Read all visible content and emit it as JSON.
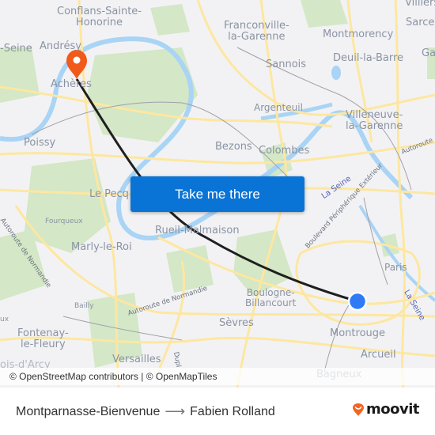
{
  "map": {
    "places": [
      {
        "name": "Conflans-Sainte-\nHonorine",
        "size": "lg"
      },
      {
        "name": "Andrésy",
        "size": "lg"
      },
      {
        "name": "-Seine",
        "size": "lg"
      },
      {
        "name": "Achères",
        "size": "lg"
      },
      {
        "name": "Poissy",
        "size": "lg"
      },
      {
        "name": "Franconville-\nla-Garenne",
        "size": "lg"
      },
      {
        "name": "Sannois",
        "size": "lg"
      },
      {
        "name": "Montmorency",
        "size": "lg"
      },
      {
        "name": "Deuil-la-Barre",
        "size": "lg"
      },
      {
        "name": "Villiers",
        "size": "lg"
      },
      {
        "name": "Sarce",
        "size": "lg"
      },
      {
        "name": "Ga",
        "size": "lg"
      },
      {
        "name": "Argenteuil",
        "size": "md"
      },
      {
        "name": "Villeneuve-\nla-Garenne",
        "size": "lg"
      },
      {
        "name": "Bezons",
        "size": "lg"
      },
      {
        "name": "Colombes",
        "size": "lg"
      },
      {
        "name": "Le Pecq",
        "size": "lg"
      },
      {
        "name": "Fourqueux",
        "size": "sm"
      },
      {
        "name": "Rueil-Malmaison",
        "size": "lg"
      },
      {
        "name": "Marly-le-Roi",
        "size": "lg"
      },
      {
        "name": "Paris",
        "size": "md"
      },
      {
        "name": "Boulogne-\nBillancourt",
        "size": "md"
      },
      {
        "name": "Bailly",
        "size": "sm"
      },
      {
        "name": "ux",
        "size": "sm"
      },
      {
        "name": "Fontenay-\nle-Fleury",
        "size": "lg"
      },
      {
        "name": "Sèvres",
        "size": "lg"
      },
      {
        "name": "Montrouge",
        "size": "lg"
      },
      {
        "name": "Arcueil",
        "size": "lg"
      },
      {
        "name": "Versailles",
        "size": "lg"
      },
      {
        "name": "Bagneux",
        "size": "lg"
      },
      {
        "name": "ois-d'Arcy",
        "size": "lg"
      }
    ],
    "roads": [
      "Autoroute de Normandie",
      "Autoroute de Normandie",
      "Boulevard Périphérique Extérieur",
      "Autoroute",
      "Dupl"
    ],
    "water": [
      "La Seine",
      "La Seine"
    ],
    "origin_marker": {
      "label": "Montparnasse-Bienvenue",
      "color": "#2f7bf5"
    },
    "destination_marker": {
      "label": "Achères",
      "color": "#f05a1a"
    },
    "route_color": "#1f1f1f"
  },
  "cta": {
    "label": "Take me there"
  },
  "attribution": "© OpenStreetMap contributors | © OpenMapTiles",
  "footer": {
    "origin": "Montparnasse-Bienvenue",
    "arrow": "⟶",
    "destination": "Fabien Rolland",
    "brand": "moovit",
    "brand_color": "#f26522"
  }
}
